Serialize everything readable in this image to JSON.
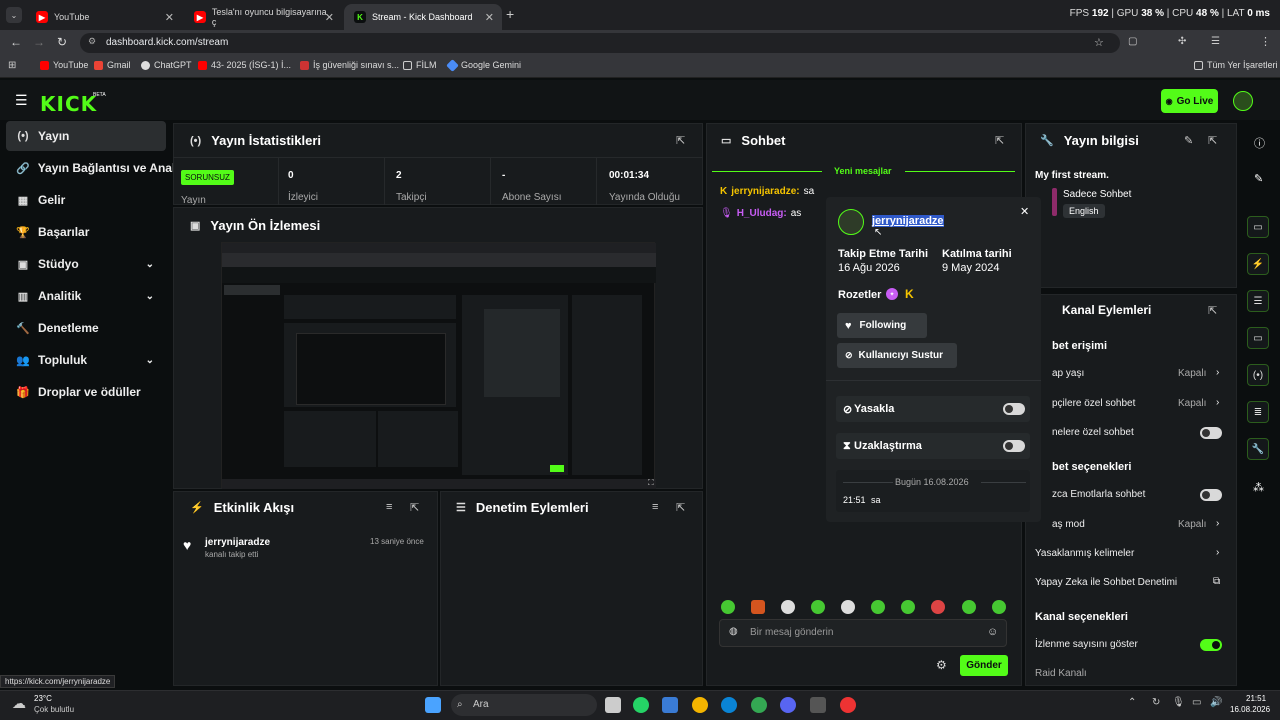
{
  "browser": {
    "tabs": [
      {
        "label": "YouTube"
      },
      {
        "label": "Tesla'nı oyuncu bilgisayarına ç"
      },
      {
        "label": "Stream - Kick Dashboard"
      }
    ],
    "new_tab": "+",
    "perf": {
      "fps_label": "FPS",
      "fps": "192",
      "gpu_label": "GPU",
      "gpu": "38 %",
      "cpu_label": "CPU",
      "cpu": "48 %",
      "lat_label": "LAT",
      "lat": "0 ms"
    },
    "url": "dashboard.kick.com/stream",
    "bookmarks": [
      "YouTube",
      "Gmail",
      "ChatGPT",
      "43- 2025 (İSG-1) İ...",
      "İş güvenliği sınavı s...",
      "FİLM",
      "Google Gemini"
    ],
    "all_bookmarks": "Tüm Yer İşaretleri",
    "status_url": "https://kick.com/jerrynijaradze"
  },
  "kick": {
    "logo": "KICK",
    "logo_beta": "BETA",
    "go_live": "Go Live",
    "sidebar": [
      {
        "label": "Yayın",
        "icon": "(•)"
      },
      {
        "label": "Yayın Bağlantısı ve Anahtarı",
        "icon": "🔗"
      },
      {
        "label": "Gelir",
        "icon": "▦"
      },
      {
        "label": "Başarılar",
        "icon": "🏆"
      },
      {
        "label": "Stüdyo",
        "icon": "▣"
      },
      {
        "label": "Analitik",
        "icon": "▥"
      },
      {
        "label": "Denetleme",
        "icon": "🔨"
      },
      {
        "label": "Topluluk",
        "icon": "👥"
      },
      {
        "label": "Droplar ve ödüller",
        "icon": "🎁"
      }
    ],
    "stats": {
      "title": "Yayın İstatistikleri",
      "status_badge": "SORUNSUZ",
      "status_label": "Yayın",
      "items": [
        {
          "value": "0",
          "label": "İzleyici"
        },
        {
          "value": "2",
          "label": "Takipçi"
        },
        {
          "value": "-",
          "label": "Abone Sayısı"
        },
        {
          "value": "00:01:34",
          "label": "Yayında Olduğu"
        }
      ]
    },
    "preview": {
      "title": "Yayın Ön İzlemesi"
    },
    "activity": {
      "title": "Etkinlik Akışı",
      "user": "jerrynijaradze",
      "text": "kanalı takip etti",
      "time": "13 saniye önce"
    },
    "mod_actions": {
      "title": "Denetim Eylemleri"
    },
    "chat": {
      "title": "Sohbet",
      "new_messages": "Yeni mesajlar",
      "messages": [
        {
          "user": "jerrynijaradze:",
          "text": "sa",
          "color": "#f5c400"
        },
        {
          "user": "H_Uludag:",
          "text": "as",
          "color": "#c85df5"
        }
      ],
      "input_placeholder": "Bir mesaj gönderin",
      "send": "Gönder"
    },
    "user_card": {
      "username": "jerrynijaradze",
      "follow_date_label": "Takip Etme Tarihi",
      "follow_date": "16 Ağu 2026",
      "join_date_label": "Katılma tarihi",
      "join_date": "9 May 2024",
      "badges_label": "Rozetler",
      "following": "Following",
      "mute": "Kullanıcıyı Sustur",
      "ban": "Yasakla",
      "timeout": "Uzaklaştırma",
      "date_divider": "Bugün 16.08.2026",
      "log_time": "21:51",
      "log_text": "sa"
    },
    "stream_info": {
      "title": "Yayın bilgisi",
      "stream_title": "My first stream.",
      "category": "Sadece Sohbet",
      "language": "English"
    },
    "channel_actions": {
      "title": "Kanal Eylemleri",
      "section1": "bet erişimi",
      "rows": [
        {
          "label": "ap yaşı",
          "value": "Kapalı"
        },
        {
          "label": "pçilere özel sohbet",
          "value": "Kapalı"
        },
        {
          "label": "nelere özel sohbet",
          "value": ""
        }
      ],
      "section2": "bet seçenekleri",
      "rows2": [
        {
          "label": "zca Emotlarla sohbet",
          "value": ""
        },
        {
          "label": "aş mod",
          "value": "Kapalı"
        },
        {
          "label": "Yasaklanmış kelimeler",
          "value": ""
        },
        {
          "label": "Yapay Zeka ile Sohbet Denetimi",
          "value": ""
        }
      ],
      "section3": "Kanal seçenekleri",
      "show_viewers": "İzlenme sayısını göster",
      "raid": "Raid Kanalı"
    }
  },
  "taskbar": {
    "weather_temp": "23°C",
    "weather_text": "Çok bulutlu",
    "search": "Ara",
    "time": "21:51",
    "date": "16.08.2026"
  }
}
